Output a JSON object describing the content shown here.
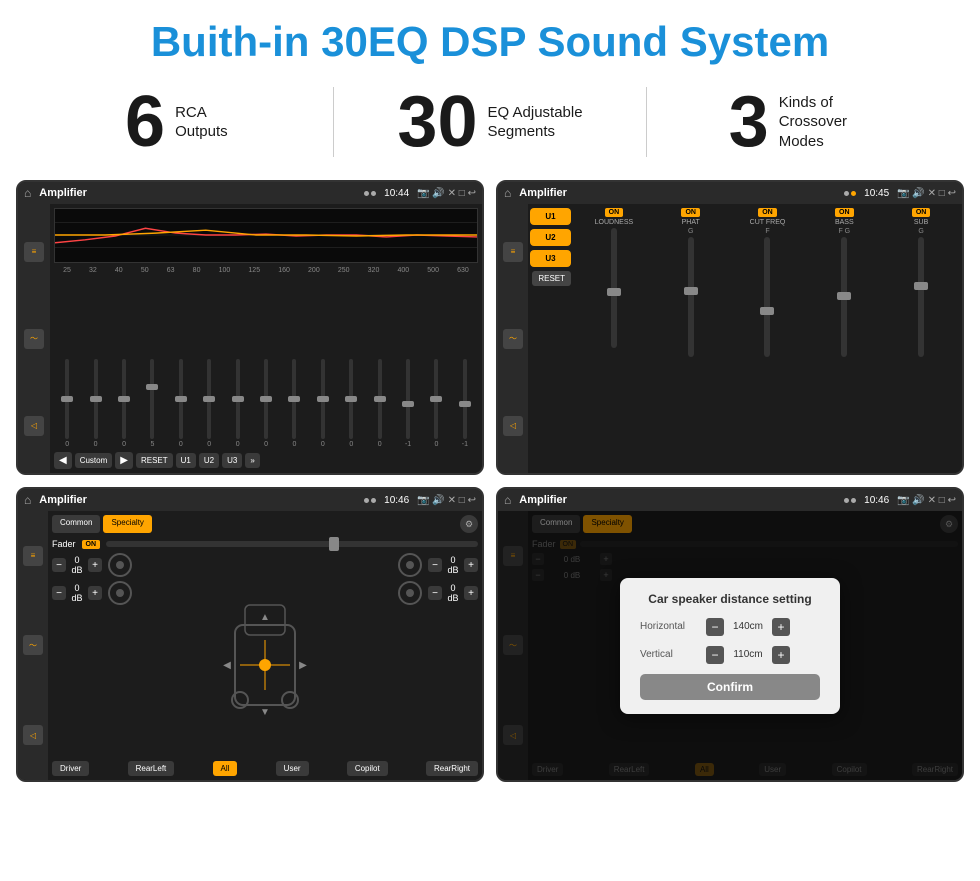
{
  "title": "Buith-in 30EQ DSP Sound System",
  "stats": [
    {
      "number": "6",
      "label": "RCA\nOutputs"
    },
    {
      "number": "30",
      "label": "EQ Adjustable\nSegments"
    },
    {
      "number": "3",
      "label": "Kinds of\nCrossover Modes"
    }
  ],
  "screens": [
    {
      "id": "screen1",
      "status": {
        "title": "Amplifier",
        "time": "10:44"
      },
      "eq_labels": [
        "25",
        "32",
        "40",
        "50",
        "63",
        "80",
        "100",
        "125",
        "160",
        "200",
        "250",
        "320",
        "400",
        "500",
        "630"
      ],
      "eq_values": [
        "0",
        "0",
        "0",
        "5",
        "0",
        "0",
        "0",
        "0",
        "0",
        "0",
        "0",
        "0",
        "-1",
        "0",
        "-1"
      ],
      "bottom_btns": [
        "Custom",
        "RESET",
        "U1",
        "U2",
        "U3"
      ]
    },
    {
      "id": "screen2",
      "status": {
        "title": "Amplifier",
        "time": "10:45"
      },
      "presets": [
        "U1",
        "U2",
        "U3"
      ],
      "channels": [
        {
          "name": "LOUDNESS",
          "on": true
        },
        {
          "name": "PHAT",
          "on": true
        },
        {
          "name": "CUT FREQ",
          "on": true
        },
        {
          "name": "BASS",
          "on": true
        },
        {
          "name": "SUB",
          "on": true
        }
      ],
      "reset_label": "RESET"
    },
    {
      "id": "screen3",
      "status": {
        "title": "Amplifier",
        "time": "10:46"
      },
      "tabs": [
        "Common",
        "Specialty"
      ],
      "fader_label": "Fader",
      "fader_on": "ON",
      "zones": [
        {
          "label": "0 dB"
        },
        {
          "label": "0 dB"
        },
        {
          "label": "0 dB"
        },
        {
          "label": "0 dB"
        }
      ],
      "bottom_btns": [
        "Driver",
        "RearLeft",
        "All",
        "User",
        "Copilot",
        "RearRight"
      ]
    },
    {
      "id": "screen4",
      "status": {
        "title": "Amplifier",
        "time": "10:46"
      },
      "dialog": {
        "title": "Car speaker distance setting",
        "rows": [
          {
            "label": "Horizontal",
            "value": "140cm"
          },
          {
            "label": "Vertical",
            "value": "110cm"
          }
        ],
        "confirm_label": "Confirm"
      },
      "tabs": [
        "Common",
        "Specialty"
      ],
      "zones": [
        {
          "label": "0 dB"
        },
        {
          "label": "0 dB"
        }
      ],
      "bottom_btns": [
        "Driver",
        "RearLeft",
        "All",
        "User",
        "Copilot",
        "RearRight"
      ]
    }
  ]
}
